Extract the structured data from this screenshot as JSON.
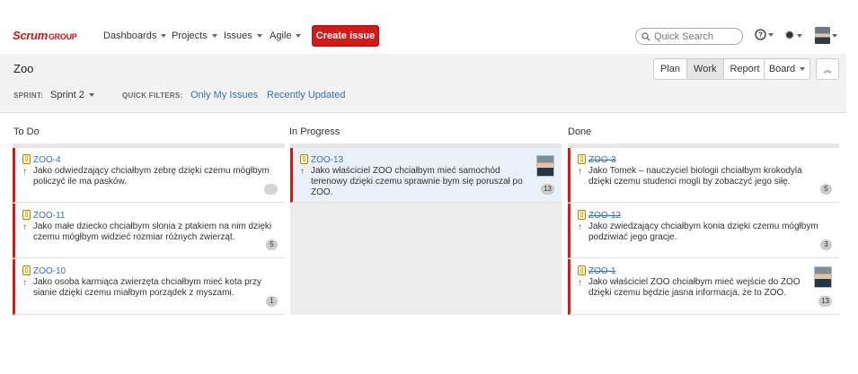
{
  "nav": {
    "logo_main": "Scrum",
    "logo_sub": "GROUP",
    "items": [
      "Dashboards",
      "Projects",
      "Issues",
      "Agile"
    ],
    "create_label": "Create issue",
    "search_placeholder": "Quick Search",
    "help_icon": "help-icon",
    "settings_icon": "gear-icon"
  },
  "board": {
    "title": "Zoo",
    "sprint_label": "SPRINT:",
    "sprint_value": "Sprint 2",
    "quick_filters_label": "QUICK FILTERS:",
    "quick_filters": [
      "Only My Issues",
      "Recently Updated"
    ],
    "modes": [
      "Plan",
      "Work",
      "Report"
    ],
    "active_mode": "Work",
    "board_menu": "Board",
    "collapse_icon": "chevron-up-double-icon"
  },
  "columns": [
    {
      "name": "To Do",
      "cards": [
        {
          "key": "ZOO-4",
          "summary_lines": [
            "Jako odwiedzający chciałbym zebrę dzięki czemu mógłbym",
            "policzyć ile ma pasków."
          ],
          "estimate": ""
        },
        {
          "key": "ZOO-11",
          "summary_lines": [
            "Jako małe dziecko chciałbym słonia z ptakiem na nim dzięki",
            "czemu mógłbym widzieć rozmiar różnych zwierząt."
          ],
          "estimate": "5"
        },
        {
          "key": "ZOO-10",
          "summary_lines": [
            "Jako osoba karmiąca zwierzęta chciałbym mieć kota przy",
            "sianie dzięki czemu miałbym porządek z myszami."
          ],
          "estimate": "1"
        }
      ]
    },
    {
      "name": "In Progress",
      "cards": [
        {
          "key": "ZOO-13",
          "summary_lines": [
            "Jako właściciel ZOO chciałbym mieć samochód",
            "terenowy dzięki czemu sprawnie bym się poruszał po",
            "ZOO."
          ],
          "estimate": "13"
        }
      ]
    },
    {
      "name": "Done",
      "cards": [
        {
          "key": "ZOO-3",
          "summary_lines": [
            "Jako Tomek – nauczyciel biologii chciałbym krokodyla",
            "dzięki czemu studenci mogli by zobaczyć jego siłę."
          ],
          "estimate": "5"
        },
        {
          "key": "ZOO-12",
          "summary_lines": [
            "Jako zwiedzający chciałbym konia dzięki czemu mógłbym",
            "podziwiać jego gracje."
          ],
          "estimate": "3"
        },
        {
          "key": "ZOO-1",
          "summary_lines": [
            "Jako właściciel ZOO chciałbym mieć wejście do ZOO",
            "dzięki czemu będzie jasna informacja, że to ZOO."
          ],
          "estimate": "13"
        }
      ]
    }
  ]
}
